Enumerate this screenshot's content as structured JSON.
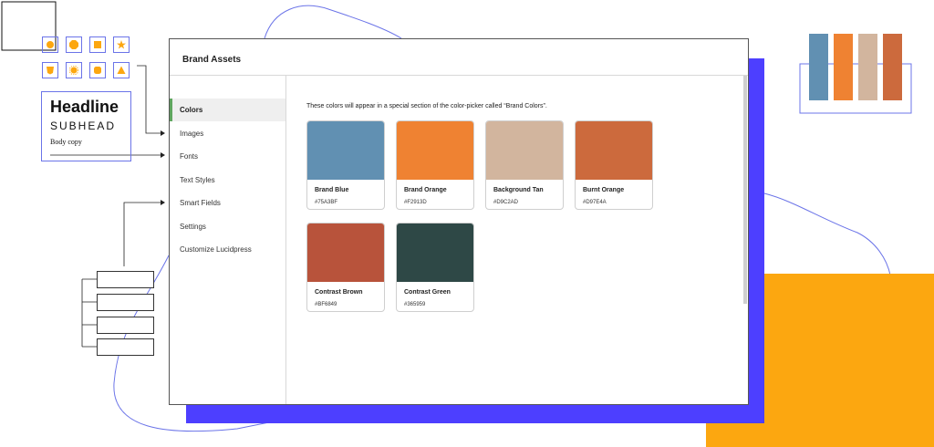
{
  "window": {
    "title": "Brand Assets"
  },
  "sidebar": {
    "items": [
      {
        "label": "Colors",
        "active": true
      },
      {
        "label": "Images",
        "active": false
      },
      {
        "label": "Fonts",
        "active": false
      },
      {
        "label": "Text Styles",
        "active": false
      },
      {
        "label": "Smart Fields",
        "active": false
      },
      {
        "label": "Settings",
        "active": false
      },
      {
        "label": "Customize Lucidpress",
        "active": false
      }
    ]
  },
  "main": {
    "description": "These colors will appear in a special section of the color-picker called “Brand Colors”.",
    "colors": [
      {
        "name": "Brand Blue",
        "hex": "#75A3BF",
        "swatch": "#6190b2"
      },
      {
        "name": "Brand Orange",
        "hex": "#F2913D",
        "swatch": "#ef8232"
      },
      {
        "name": "Background Tan",
        "hex": "#D9C2AD",
        "swatch": "#d2b59e"
      },
      {
        "name": "Burnt Orange",
        "hex": "#D97E4A",
        "swatch": "#cc6a3d"
      },
      {
        "name": "Contrast Brown",
        "hex": "#BF6849",
        "swatch": "#b8533b"
      },
      {
        "name": "Contrast Green",
        "hex": "#365959",
        "swatch": "#2e4846"
      }
    ]
  },
  "decor": {
    "type_sample": {
      "headline": "Headline",
      "subhead": "SUBHEAD",
      "body": "Body copy"
    },
    "tube_colors": [
      "#6190b2",
      "#ef8232",
      "#d2b59e",
      "#cc6a3d"
    ],
    "accent_colors": {
      "blue": "#4d3fff",
      "orange": "#fca710",
      "outline": "#6b74e8"
    }
  }
}
